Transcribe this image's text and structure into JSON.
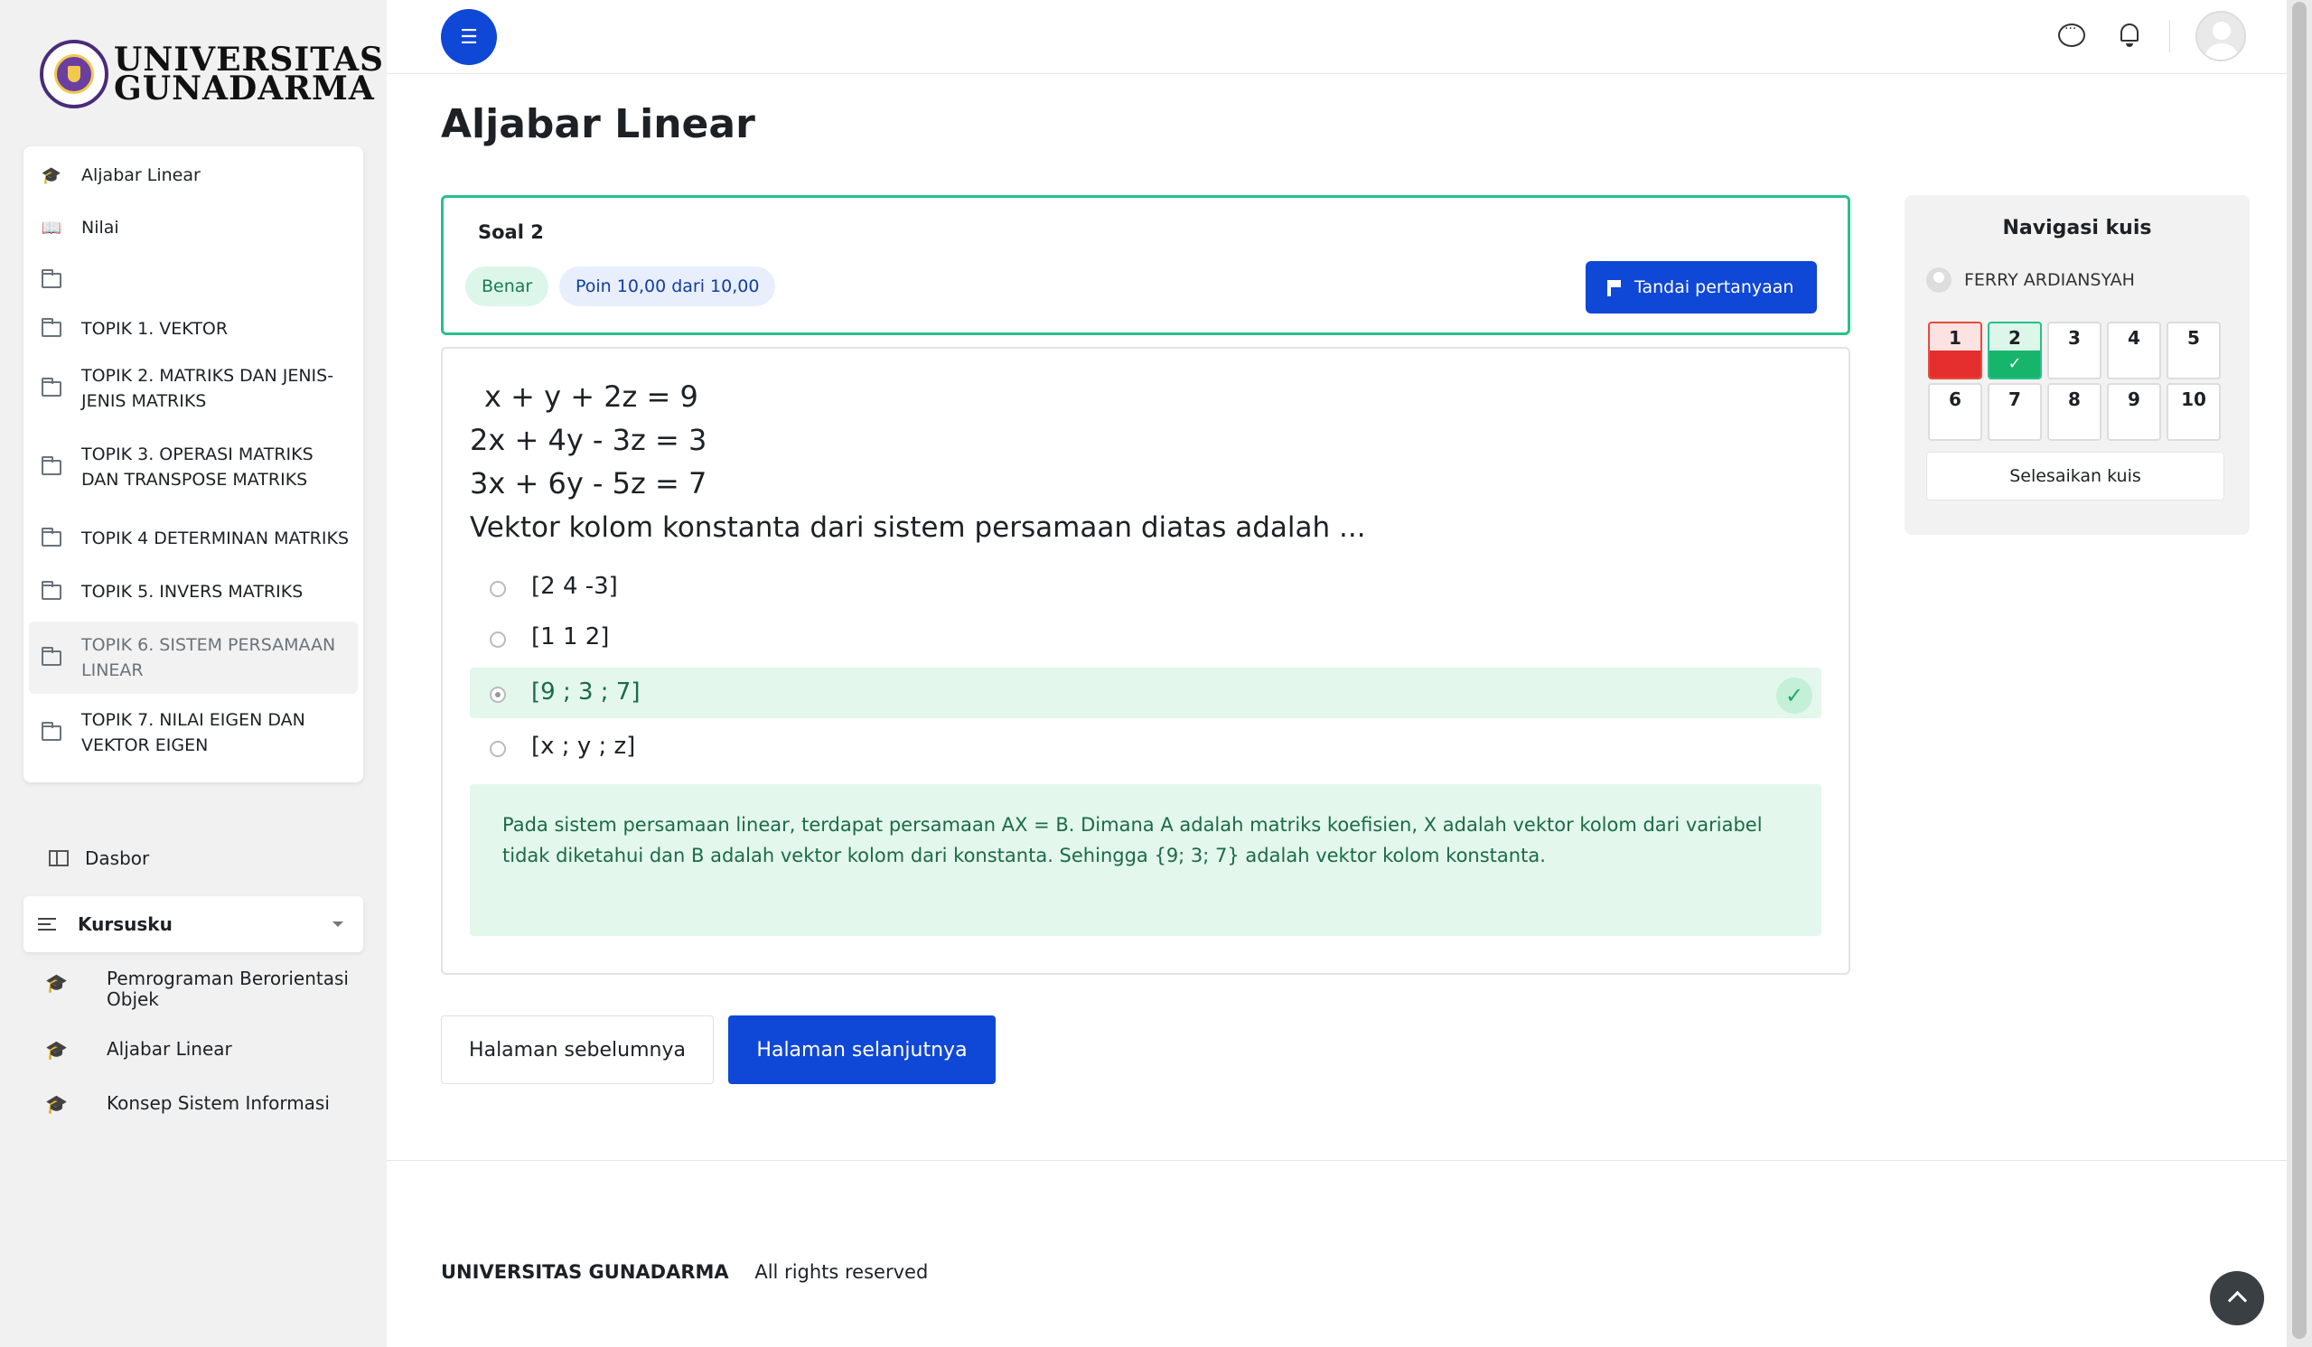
{
  "brand": {
    "logo_text_line1": "UNIVERSITAS",
    "logo_text_line2": "GUNADARMA"
  },
  "sidebar": {
    "items": [
      {
        "label": "Aljabar Linear",
        "icon": "graduation-cap-icon"
      },
      {
        "label": "Nilai",
        "icon": "book-icon"
      },
      {
        "label": "",
        "icon": "folder-icon"
      },
      {
        "label": "TOPIK 1. VEKTOR",
        "icon": "folder-icon"
      },
      {
        "label": "TOPIK 2. MATRIKS DAN JENIS-JENIS MATRIKS",
        "icon": "folder-icon"
      },
      {
        "label": "TOPIK 3. OPERASI MATRIKS DAN TRANSPOSE MATRIKS",
        "icon": "folder-icon"
      },
      {
        "label": "TOPIK 4 DETERMINAN MATRIKS",
        "icon": "folder-icon"
      },
      {
        "label": "TOPIK 5. INVERS MATRIKS",
        "icon": "folder-icon"
      },
      {
        "label": "TOPIK 6. SISTEM PERSAMAAN LINEAR",
        "icon": "folder-icon",
        "active": true
      },
      {
        "label": "TOPIK 7. NILAI EIGEN DAN VEKTOR EIGEN",
        "icon": "folder-icon"
      }
    ],
    "dasbor": "Dasbor",
    "kursusku": "Kursusku",
    "courses": [
      "Pemrograman Berorientasi Objek",
      "Aljabar Linear",
      "Konsep Sistem Informasi"
    ]
  },
  "page": {
    "title": "Aljabar Linear"
  },
  "question": {
    "number_label": "Soal 2",
    "status": "Benar",
    "points": "Poin 10,00 dari 10,00",
    "flag_button": "Tandai pertanyaan",
    "equations": [
      "x +   y + 2z = 9",
      "2x + 4y - 3z = 3",
      "3x + 6y - 5z = 7"
    ],
    "text": "Vektor kolom konstanta dari sistem persamaan diatas adalah ...",
    "options": [
      {
        "label": "[2 4 -3]",
        "selected": false,
        "correct": false
      },
      {
        "label": "[1 1 2]",
        "selected": false,
        "correct": false
      },
      {
        "label": "[9 ; 3 ; 7]",
        "selected": true,
        "correct": true
      },
      {
        "label": "[x ; y ; z]",
        "selected": false,
        "correct": false
      }
    ],
    "feedback": "Pada sistem persamaan linear, terdapat persamaan AX = B. Dimana A adalah matriks koefisien, X adalah vektor kolom dari variabel tidak diketahui dan B adalah vektor kolom dari konstanta. Sehingga {9; 3; 7} adalah vektor kolom konstanta."
  },
  "pagination": {
    "prev": "Halaman sebelumnya",
    "next": "Halaman selanjutnya"
  },
  "quiz_nav": {
    "title": "Navigasi kuis",
    "user": "FERRY ARDIANSYAH",
    "questions": [
      "1",
      "2",
      "3",
      "4",
      "5",
      "6",
      "7",
      "8",
      "9",
      "10"
    ],
    "finish": "Selesaikan kuis"
  },
  "footer": {
    "brand": "UNIVERSITAS GUNADARMA",
    "text": "All rights reserved"
  },
  "colors": {
    "primary": "#0f47d6",
    "correct": "#27c18a",
    "wrong": "#e52e2e",
    "sidebar_bg": "#f1f1f1"
  }
}
